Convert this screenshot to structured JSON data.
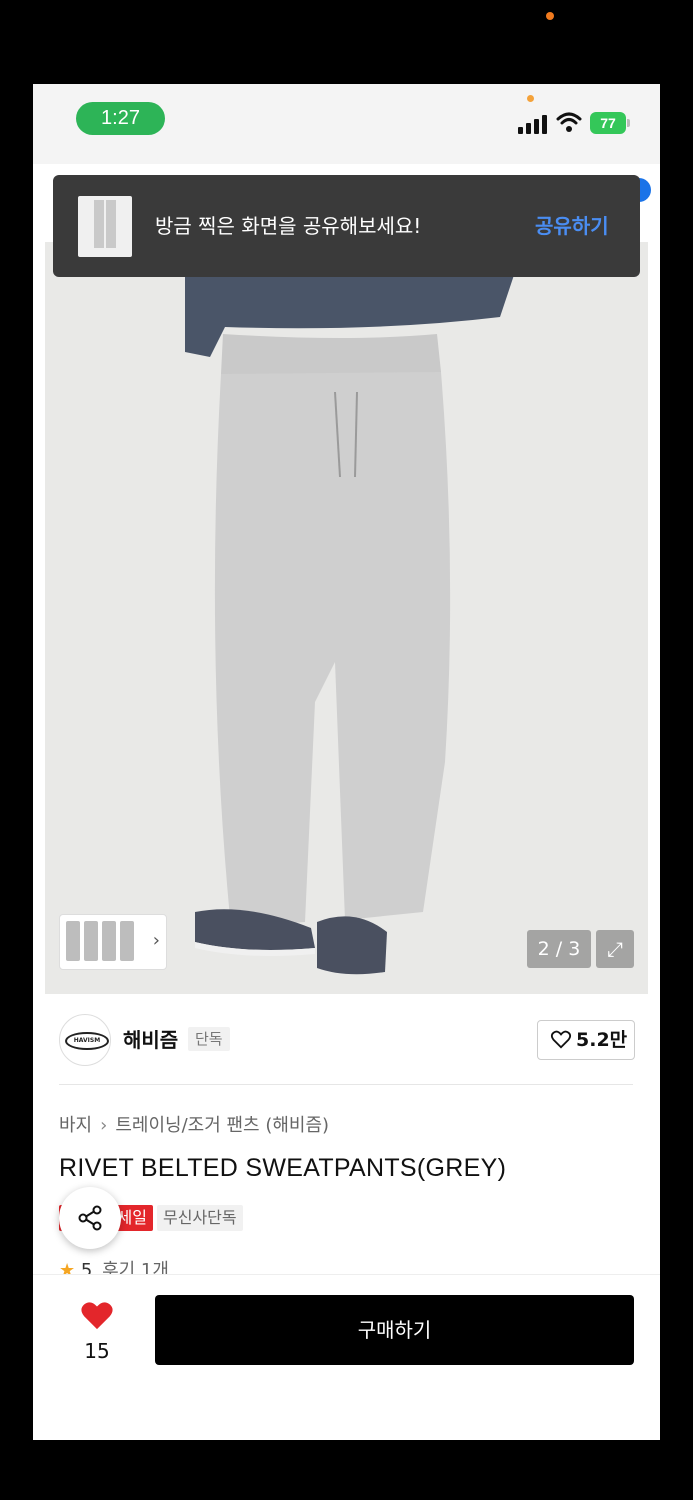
{
  "status_bar": {
    "time": "1:27",
    "battery": "77"
  },
  "share_toast": {
    "message": "방금 찍은 화면을 공유해보세요!",
    "action": "공유하기"
  },
  "gallery": {
    "page_counter": "2 / 3"
  },
  "brand": {
    "name": "해비즘",
    "badge": "단독",
    "logo_text": "HAVISM",
    "likes": "5.2만"
  },
  "breadcrumb": [
    "바지",
    "트레이닝/조거 팬츠 (해비즘)"
  ],
  "product": {
    "title": "RIVET BELTED SWEATPANTS(GREY)",
    "sale_tag": "세일",
    "exclusive_tag": "무신사단독"
  },
  "rating": {
    "score": "5",
    "reviews": "후기 1개"
  },
  "bottom_bar": {
    "wish_count": "15",
    "buy_label": "구매하기"
  },
  "colors": {
    "accent_blue": "#4a8df2",
    "sale_red": "#e3262b",
    "time_pill": "#2db457"
  },
  "icons": [
    "signal-icon",
    "wifi-icon",
    "battery-icon",
    "chevron-right-icon",
    "expand-icon",
    "heart-outline-icon",
    "share-icon",
    "star-icon",
    "heart-filled-icon"
  ]
}
